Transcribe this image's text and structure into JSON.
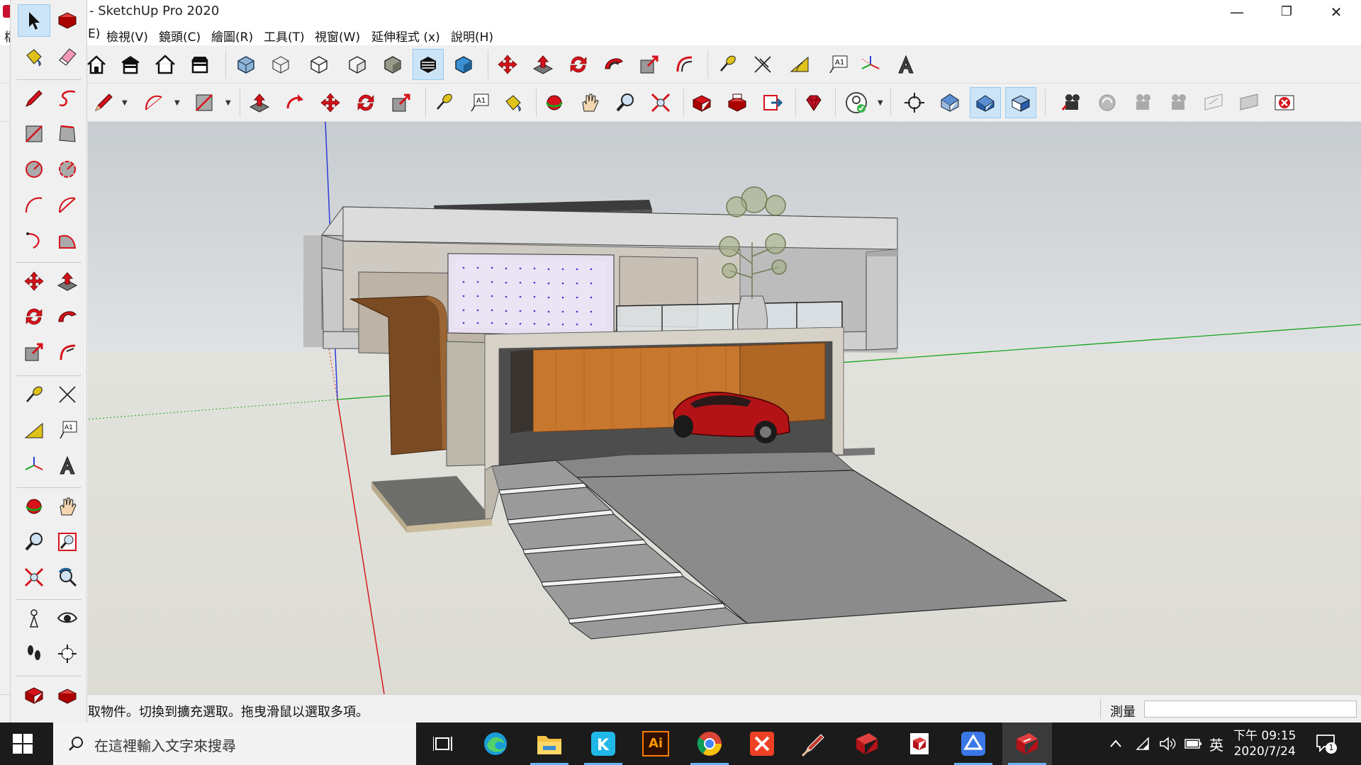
{
  "window": {
    "title": "- SketchUp Pro 2020",
    "minimize": "—",
    "restore": "❐",
    "close": "✕"
  },
  "menu": {
    "items": [
      "E)",
      "檢視(V)",
      "鏡頭(C)",
      "繪圖(R)",
      "工具(T)",
      "視窗(W)",
      "延伸程式 (x)",
      "說明(H)"
    ],
    "cut_prefix": "檔"
  },
  "toolbar_top": {
    "icons": [
      "warehouse-home-icon",
      "warehouse-share-icon",
      "warehouse-share-model-icon",
      "extension-warehouse-icon",
      "xray-icon",
      "wireframe-icon",
      "hidden-line-icon",
      "shaded-icon",
      "shaded-textures-icon",
      "monochrome-icon",
      "back-edges-icon",
      "move-icon",
      "push-pull-icon",
      "rotate-icon",
      "follow-me-icon",
      "scale-icon",
      "offset-icon",
      "tape-measure-icon",
      "dimension-icon",
      "protractor-icon",
      "text-icon",
      "axes-icon",
      "3d-text-icon"
    ],
    "active": "monochrome-icon"
  },
  "toolbar_second": {
    "icons": [
      "pencil-icon",
      "arc-icon",
      "rectangle-icon",
      "push-pull-icon",
      "follow-me-icon",
      "move-icon",
      "rotate-icon",
      "scale-icon",
      "tape-measure-icon",
      "text-icon",
      "paint-bucket-icon",
      "orbit-icon",
      "pan-icon",
      "zoom-icon",
      "zoom-extents-icon",
      "model-info-icon",
      "components-icon",
      "export-icon",
      "ruby-console-icon",
      "profile-icon",
      "position-camera-icon",
      "top-view-icon",
      "iso-view-icon",
      "front-view-icon",
      "add-scene-icon",
      "scene-sync-icon",
      "walk-icon",
      "look-around-icon",
      "section-plane-icon",
      "section-display-icon",
      "section-delete-icon"
    ],
    "active": [
      "iso-view-icon",
      "front-view-icon"
    ]
  },
  "left_toolbar": {
    "icons": [
      "select-icon",
      "make-component-icon",
      "paint-bucket-icon",
      "eraser-icon",
      "pencil-icon",
      "freehand-icon",
      "rectangle-icon",
      "rotated-rectangle-icon",
      "circle-icon",
      "polygon-icon",
      "arc-icon",
      "two-point-arc-icon",
      "three-point-arc-icon",
      "pie-icon",
      "move-icon",
      "push-pull-icon",
      "rotate-icon",
      "follow-me-icon",
      "scale-icon",
      "offset-icon",
      "tape-measure-icon",
      "dimension-icon",
      "protractor-icon",
      "text-icon",
      "axes-icon",
      "3d-text-icon",
      "orbit-icon",
      "pan-icon",
      "zoom-icon",
      "zoom-window-icon",
      "zoom-extents-icon",
      "previous-view-icon",
      "position-camera-icon",
      "look-around-icon",
      "walk-icon",
      "section-plane-icon",
      "model-info-icon",
      "components-icon"
    ],
    "active": "select-icon"
  },
  "colors": {
    "axis_blue": "#2b3bd6",
    "axis_red": "#d11c1c",
    "axis_green": "#16a51c",
    "sky": "#c9ced2",
    "ground": "#dcdcd5",
    "selection": "#cce4f7",
    "taskbar": "#1b1b1b",
    "car": "#b31217",
    "wood": "#c8772e"
  },
  "status": {
    "hint": "取物件。切換到擴充選取。拖曳滑鼠以選取多項。",
    "measure_label": "測量",
    "measure_value": ""
  },
  "taskbar": {
    "search_placeholder": "在這裡輸入文字來搜尋",
    "apps": [
      "task-view-icon",
      "edge-icon",
      "file-explorer-icon",
      "kinza-icon",
      "illustrator-icon",
      "chrome-icon",
      "xmind-icon",
      "style-builder-icon",
      "layout-icon",
      "sketchup-viewer-icon",
      "google-drive-icon",
      "sketchup-icon"
    ],
    "illustrator_label": "Ai",
    "ime": "英",
    "time": "下午 09:15",
    "date": "2020/7/24",
    "notification_count": "1"
  }
}
